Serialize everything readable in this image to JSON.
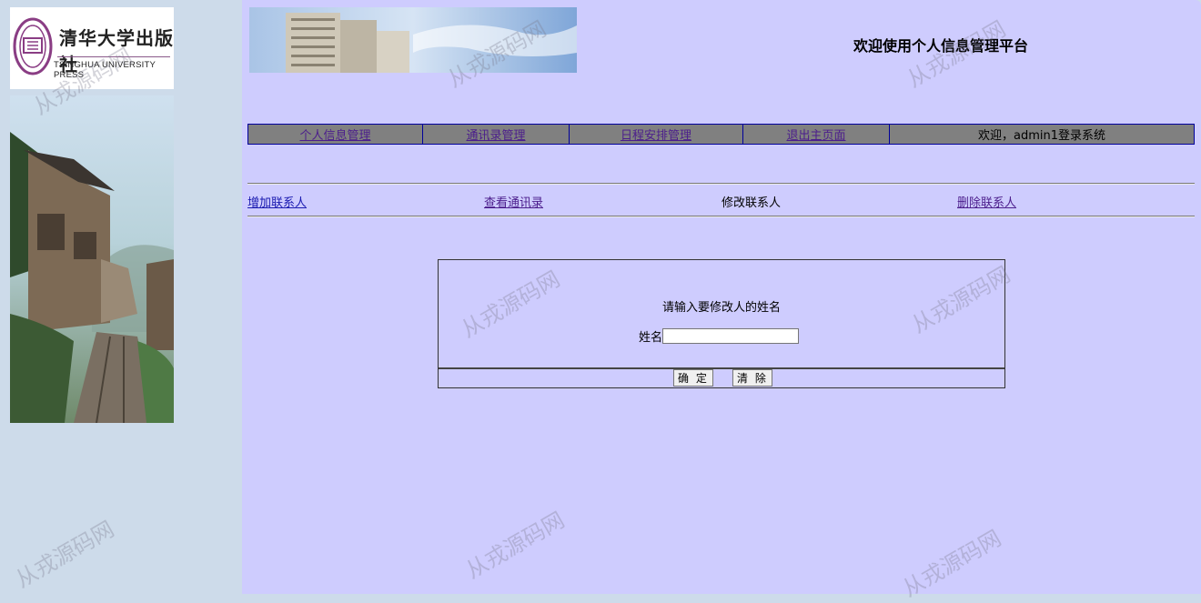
{
  "logo": {
    "publisher_cn": "清华大学出版社",
    "publisher_en": "TSINGHUA UNIVERSITY PRESS"
  },
  "header": {
    "title": "欢迎使用个人信息管理平台"
  },
  "nav": {
    "items": [
      "个人信息管理",
      "通讯录管理",
      "日程安排管理",
      "退出主页面"
    ],
    "status": "欢迎，admin1登录系统"
  },
  "subnav": {
    "add": "增加联系人",
    "view": "查看通讯录",
    "modify": "修改联系人",
    "delete": "删除联系人"
  },
  "form": {
    "prompt": "请输入要修改人的姓名",
    "name_label": "姓名",
    "name_value": "",
    "submit_label": "确 定",
    "reset_label": "清 除"
  },
  "watermark": "从戎源码网",
  "colors": {
    "sidebar_bg": "#cddbea",
    "main_bg": "#ceccfe",
    "nav_bg": "#808080",
    "nav_border": "#00009a",
    "link": "#1a1ab0",
    "visited_link": "#4b1d8c"
  }
}
